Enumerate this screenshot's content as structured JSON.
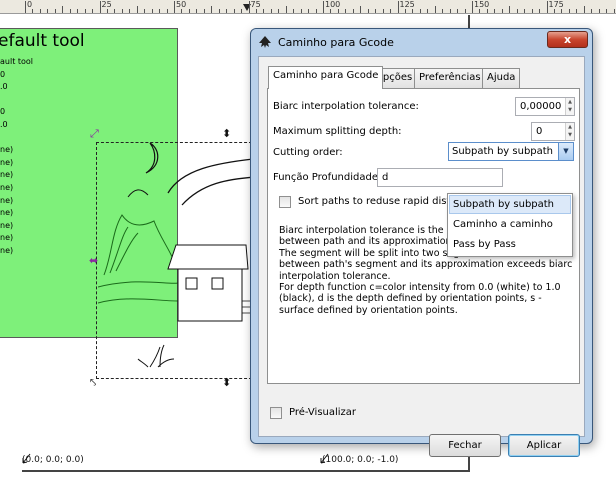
{
  "ruler": {
    "labels": [
      "0",
      "25",
      "50",
      "75",
      "100",
      "125",
      "150",
      "175"
    ]
  },
  "canvas": {
    "green_box": {
      "title": "efault tool",
      "lines": [
        "ault tool",
        "0",
        ".0",
        "",
        "0",
        ".0",
        "",
        "ne)",
        "ne)",
        "ne)",
        "ne)",
        "ne)",
        "ne)",
        "ne)",
        "ne)",
        "ne)",
        "",
        "",
        ""
      ]
    },
    "coord_left": "(0.0; 0.0; 0.0)",
    "coord_right": "(100.0; 0.0; -1.0)"
  },
  "dialog": {
    "title": "Caminho para Gcode",
    "close_label": "x",
    "tabs": [
      {
        "label": "Caminho para Gcode",
        "active": true
      },
      {
        "label": "Opções",
        "active": false
      },
      {
        "label": "Preferências",
        "active": false
      },
      {
        "label": "Ajuda",
        "active": false
      }
    ],
    "biarc_label": "Biarc interpolation tolerance:",
    "biarc_value": "0,00000",
    "depth_label": "Maximum splitting depth:",
    "depth_value": "0",
    "cutting_label": "Cutting order:",
    "cutting_value": "Subpath by subpath",
    "funcao_label": "Função Profundidade:",
    "funcao_value": "d",
    "sort_label": "Sort paths to reduse rapid distanc",
    "sort_checked": false,
    "dropdown_options": [
      "Subpath by subpath",
      "Caminho a caminho",
      "Pass by Pass"
    ],
    "help_lines": [
      "Biarc interpolation tolerance is the maximum distance",
      "between path and its approximation.",
      "The segment will be split into two segments if the distance",
      "between path's segment and its approximation exceeds biarc",
      "interpolation tolerance.",
      "For depth function c=color intensity from 0.0 (white) to 1.0",
      "(black), d is the depth defined by orientation points, s -",
      "surface defined by orientation points."
    ],
    "preview_label": "Pré-Visualizar",
    "preview_checked": false,
    "fechar_label": "Fechar",
    "aplicar_label": "Aplicar"
  },
  "colors": {
    "green_fill": "#7ef07a",
    "dialog_frame": "#b9d1ea",
    "selection_handle": "#8a2aa0"
  }
}
